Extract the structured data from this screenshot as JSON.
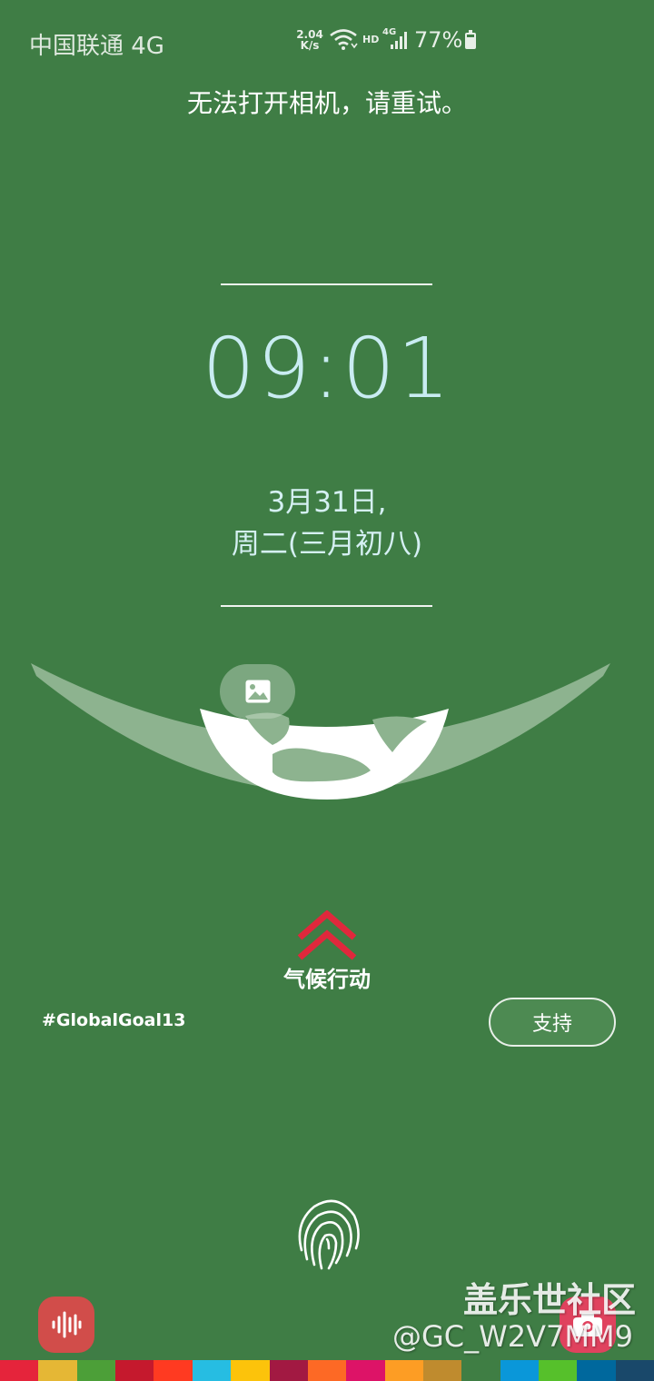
{
  "status_bar": {
    "carrier": "中国联通 4G",
    "net_speed_value": "2.04",
    "net_speed_unit": "K/s",
    "hd_label": "HD",
    "signal_label": "4G",
    "battery_percent": "77%"
  },
  "toast": {
    "message": "无法打开相机，请重试。"
  },
  "lock_screen": {
    "time": "09:01",
    "date_line1": "3月31日,",
    "date_line2": "周二(三月初八)"
  },
  "campaign": {
    "label": "气候行动",
    "hashtag": "#GlobalGoal13",
    "support_label": "支持"
  },
  "icons": {
    "wallpaper": "image-icon",
    "swipe": "double-chevron-up-icon",
    "fingerprint": "fingerprint-icon",
    "voice": "voice-waveform-icon",
    "camera": "camera-icon"
  },
  "watermark": {
    "title": "盖乐世社区",
    "user": "@GC_W2V7MM9"
  },
  "colors": {
    "background": "#3f7d45",
    "clock": "#c9ecf2",
    "accent_red": "#e0283c",
    "sdg_strip": [
      "#e5243b",
      "#e5b735",
      "#4c9f38",
      "#c5192d",
      "#ff3a21",
      "#26bde2",
      "#fcc30b",
      "#a21942",
      "#fd6925",
      "#dd1367",
      "#fd9d24",
      "#bf8b2e",
      "#3f7e44",
      "#0a97d9",
      "#56c02b",
      "#00689d",
      "#19486a"
    ]
  }
}
